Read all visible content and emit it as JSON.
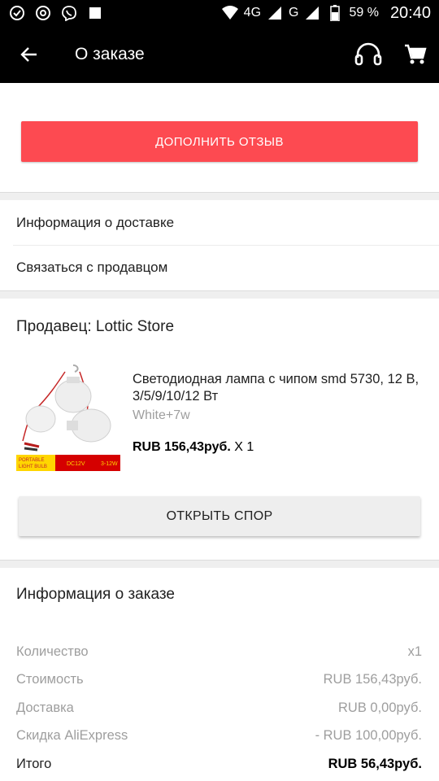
{
  "status_bar": {
    "network": "4G",
    "network2": "G",
    "battery": "59 %",
    "time": "20:40"
  },
  "toolbar": {
    "title": "О заказе",
    "icons": [
      "back-arrow-icon",
      "headset-icon",
      "cart-icon"
    ]
  },
  "actions": {
    "review_label": "ДОПОЛНИТЬ ОТЗЫВ",
    "review_color": "#fd4a51",
    "dispute_label": "ОТКРЫТЬ СПОР"
  },
  "links": {
    "delivery_info": "Информация о доставке",
    "contact_seller": "Связаться с продавцом"
  },
  "seller": {
    "name": "Продавец: Lottic Store"
  },
  "product": {
    "title": "Светодиодная лампа с чипом smd 5730, 12 В, 3/5/9/10/12 Вт",
    "variant": "White+7w",
    "price": "RUB 156,43руб.",
    "quantity": "X 1",
    "image_labels": {
      "line1": "PORTABLE",
      "line2": "LIGHT BULB",
      "voltage": "DC12V",
      "power": "3-12W"
    }
  },
  "order_info": {
    "title": "Информация о заказе",
    "rows": [
      {
        "label": "Количество",
        "value": "x1"
      },
      {
        "label": "Стоимость",
        "value": "RUB 156,43руб."
      },
      {
        "label": "Доставка",
        "value": "RUB 0,00руб."
      },
      {
        "label": "Скидка AliExpress",
        "value": "- RUB 100,00руб."
      }
    ],
    "total": {
      "label": "Итого",
      "value": "RUB 56,43руб."
    }
  }
}
